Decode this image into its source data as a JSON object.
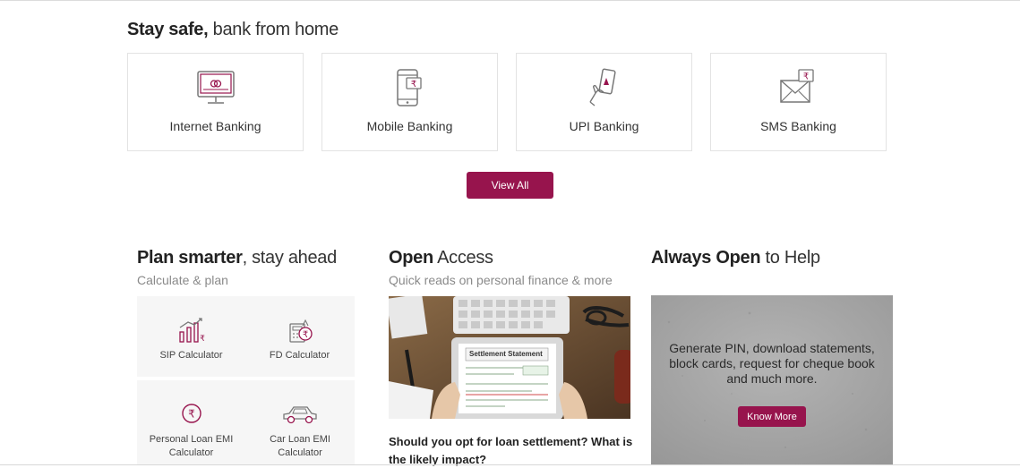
{
  "stay_safe": {
    "title_bold": "Stay safe,",
    "title_light": " bank from home",
    "cards": [
      {
        "label": "Internet Banking",
        "icon": "monitor-icon"
      },
      {
        "label": "Mobile Banking",
        "icon": "mobile-rupee-icon"
      },
      {
        "label": "UPI Banking",
        "icon": "hand-phone-icon"
      },
      {
        "label": "SMS Banking",
        "icon": "envelope-rupee-icon"
      }
    ],
    "view_all": "View All"
  },
  "plan": {
    "title_bold": "Plan smarter",
    "title_light": ", stay ahead",
    "subtitle": "Calculate & plan",
    "calculators": [
      {
        "label": "SIP Calculator",
        "icon": "sip-chart-icon"
      },
      {
        "label": "FD Calculator",
        "icon": "fd-calculator-icon"
      },
      {
        "label": "Personal Loan EMI Calculator",
        "icon": "rupee-circle-icon"
      },
      {
        "label": "Car Loan EMI Calculator",
        "icon": "car-icon"
      }
    ]
  },
  "open_access": {
    "title_bold": "Open",
    "title_light": " Access",
    "subtitle": "Quick reads on personal finance & more",
    "image_text": "Settlement Statement",
    "article_title": "Should you opt for loan settlement? What is the likely impact?"
  },
  "always_open": {
    "title_bold": "Always Open",
    "title_light": " to Help",
    "help_text": "Generate PIN, download statements, block cards, request for cheque book and much more.",
    "button": "Know More"
  },
  "colors": {
    "brand": "#97144d",
    "icon_line": "#777777",
    "accent_icon": "#97144d"
  }
}
